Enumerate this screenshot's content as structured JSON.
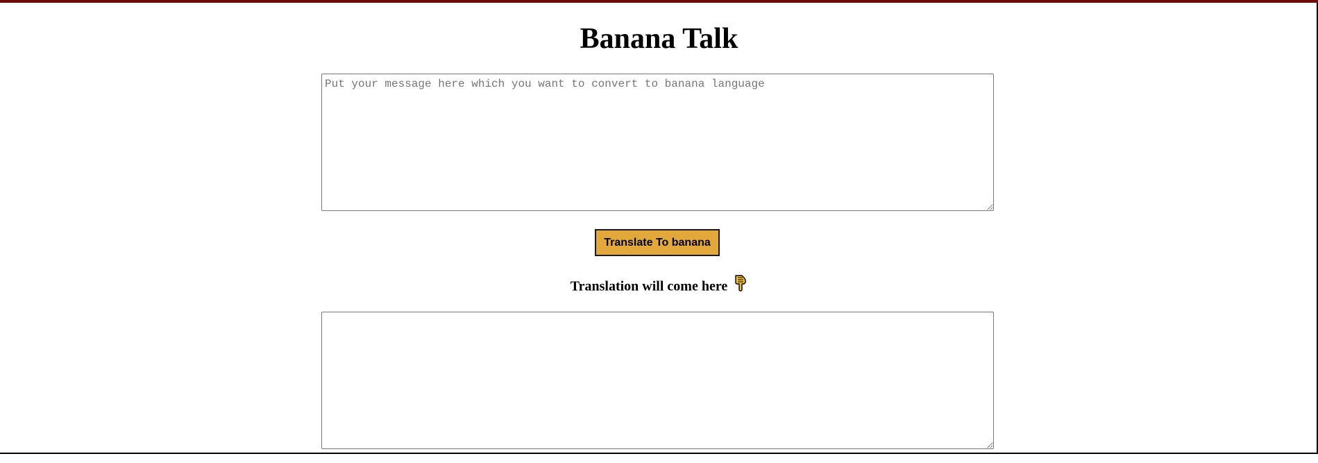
{
  "page": {
    "title": "Banana Talk"
  },
  "input": {
    "placeholder": "Put your message here which you want to convert to banana language",
    "value": ""
  },
  "actions": {
    "translate_label": "Translate To banana"
  },
  "output": {
    "label": "Translation will come here",
    "icon": "pointing-down-hand-icon",
    "value": ""
  },
  "colors": {
    "accent_border": "#6e0b0b",
    "button_bg": "#e3a83b",
    "icon_fill": "#f4c13d"
  }
}
